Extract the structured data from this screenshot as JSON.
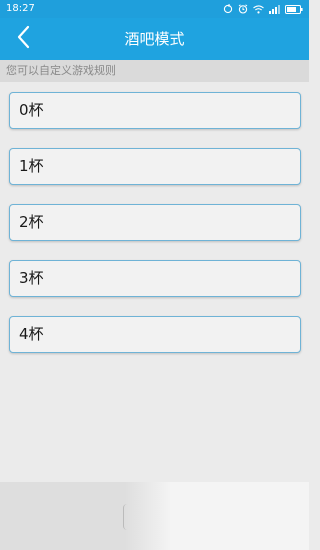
{
  "status_bar": {
    "time": "18:27",
    "icons": [
      "sync-icon",
      "alarm-icon",
      "wifi-icon",
      "signal-icon",
      "battery-icon"
    ]
  },
  "header": {
    "title": "酒吧模式",
    "back_icon": "chevron-left-icon"
  },
  "hint": "您可以自定义游戏规则",
  "options": [
    {
      "label": "0杯"
    },
    {
      "label": "1杯"
    },
    {
      "label": "2杯"
    },
    {
      "label": "3杯"
    },
    {
      "label": "4杯"
    }
  ],
  "colors": {
    "header": "#1fa3e0",
    "status_bar": "#1f9fdc",
    "background": "#ebebeb",
    "option_border": "#6fb3d6"
  }
}
